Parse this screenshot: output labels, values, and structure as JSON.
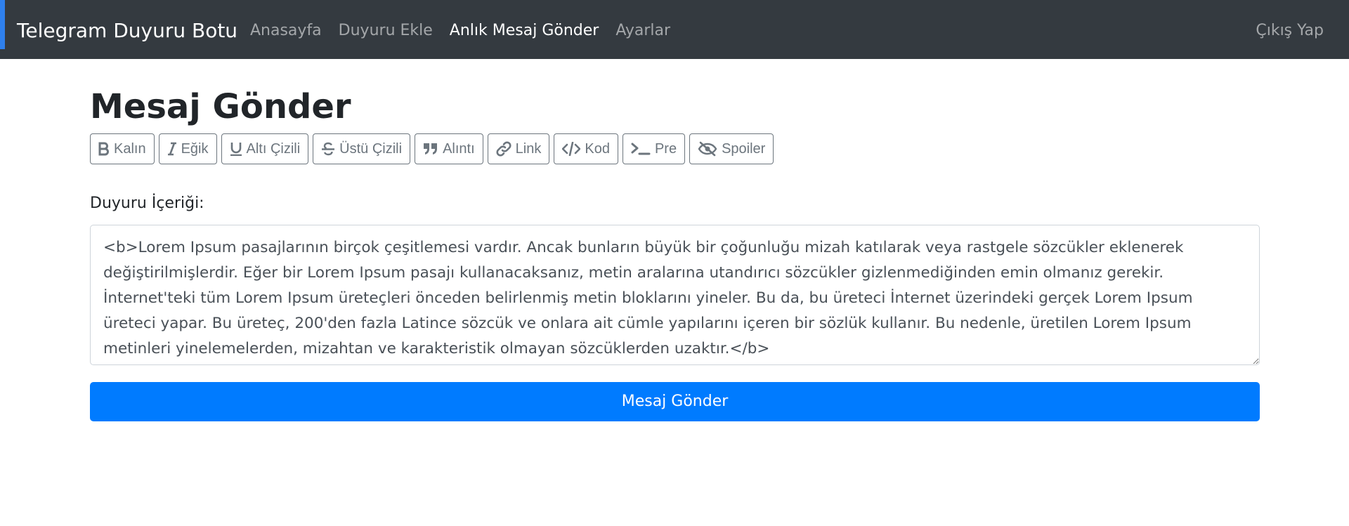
{
  "navbar": {
    "brand": "Telegram Duyuru Botu",
    "links": [
      {
        "label": "Anasayfa",
        "active": false
      },
      {
        "label": "Duyuru Ekle",
        "active": false
      },
      {
        "label": "Anlık Mesaj Gönder",
        "active": true
      },
      {
        "label": "Ayarlar",
        "active": false
      }
    ],
    "logout": "Çıkış Yap"
  },
  "main": {
    "title": "Mesaj Gönder",
    "toolbar": [
      {
        "icon": "bold-icon",
        "label": "Kalın"
      },
      {
        "icon": "italic-icon",
        "label": "Eğik"
      },
      {
        "icon": "underline-icon",
        "label": "Altı Çizili"
      },
      {
        "icon": "strikethrough-icon",
        "label": "Üstü Çizili"
      },
      {
        "icon": "quote-icon",
        "label": "Alıntı"
      },
      {
        "icon": "link-icon",
        "label": "Link"
      },
      {
        "icon": "code-icon",
        "label": "Kod"
      },
      {
        "icon": "terminal-icon",
        "label": "Pre"
      },
      {
        "icon": "eye-slash-icon",
        "label": "Spoiler"
      }
    ],
    "content_label": "Duyuru İçeriği:",
    "content_value": "<b>Lorem Ipsum pasajlarının birçok çeşitlemesi vardır. Ancak bunların büyük bir çoğunluğu mizah katılarak veya rastgele sözcükler eklenerek değiştirilmişlerdir. Eğer bir Lorem Ipsum pasajı kullanacaksanız, metin aralarına utandırıcı sözcükler gizlenmediğinden emin olmanız gerekir. İnternet'teki tüm Lorem Ipsum üreteçleri önceden belirlenmiş metin bloklarını yineler. Bu da, bu üreteci İnternet üzerindeki gerçek Lorem Ipsum üreteci yapar. Bu üreteç, 200'den fazla Latince sözcük ve onlara ait cümle yapılarını içeren bir sözlük kullanır. Bu nedenle, üretilen Lorem Ipsum metinleri yinelemelerden, mizahtan ve karakteristik olmayan sözcüklerden uzaktır.</b>",
    "submit_label": "Mesaj Gönder"
  },
  "colors": {
    "navbar_bg": "#343a40",
    "primary": "#007bff",
    "secondary": "#6c757d"
  }
}
